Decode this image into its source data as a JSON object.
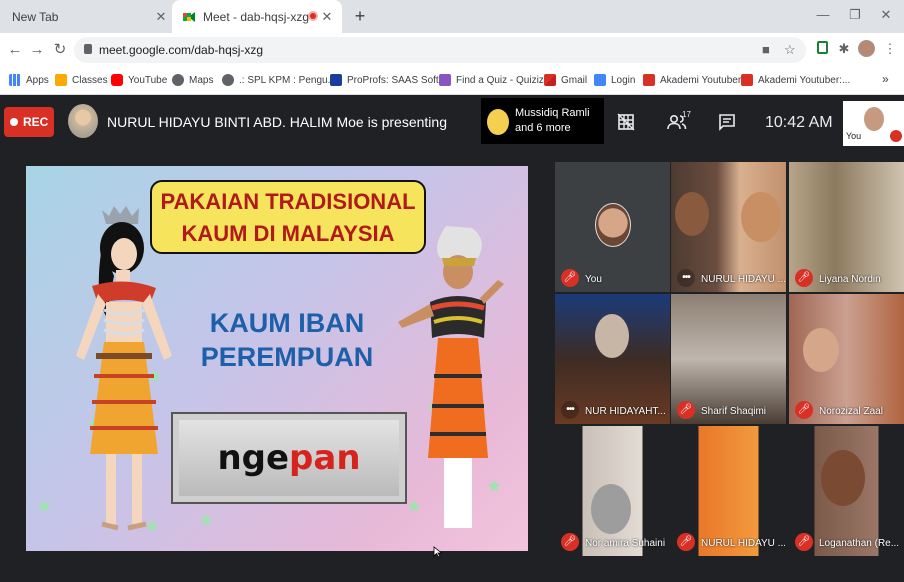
{
  "browser": {
    "tabs": [
      {
        "title": "New Tab",
        "active": false
      },
      {
        "title": "Meet - dab-hqsj-xzg",
        "active": true
      }
    ],
    "url": "meet.google.com/dab-hqsj-xzg",
    "bookmarks": [
      {
        "label": "Apps",
        "icon": "apps-grid-icon",
        "color": "#4285f4"
      },
      {
        "label": "Classes",
        "icon": "classroom-icon",
        "color": "#f9ab00"
      },
      {
        "label": "YouTube",
        "icon": "youtube-icon",
        "color": "#ff0000"
      },
      {
        "label": "Maps",
        "icon": "globe-icon",
        "color": "#5f6368"
      },
      {
        "label": ".: SPL KPM : Pengu...",
        "icon": "globe-icon",
        "color": "#5f6368"
      },
      {
        "label": "ProProfs: SAAS Soft...",
        "icon": "proprofs-icon",
        "color": "#1a3f9a"
      },
      {
        "label": "Find a Quiz - Quizizz",
        "icon": "quizizz-icon",
        "color": "#8854c0"
      },
      {
        "label": "Gmail",
        "icon": "gmail-icon",
        "color": "#d93025"
      },
      {
        "label": "Login",
        "icon": "login-icon",
        "color": "#4285f4"
      },
      {
        "label": "Akademi Youtuber",
        "icon": "akademi-icon",
        "color": "#d93025"
      },
      {
        "label": "Akademi Youtuber:...",
        "icon": "akademi-icon",
        "color": "#d93025"
      }
    ],
    "more_bookmarks": "»"
  },
  "meet": {
    "rec_label": "REC",
    "presenting_text": "NURUL HIDAYU BINTI ABD. HALIM Moe is presenting",
    "people_chip": {
      "line1": "Mussidiq Ramli",
      "line2": "and 6 more"
    },
    "participant_count": "17",
    "time": "10:42  AM",
    "self_label": "You"
  },
  "slide": {
    "title_line1": "PAKAIAN TRADISIONAL",
    "title_line2": "KAUM DI MALAYSIA",
    "subtitle_line1": "KAUM IBAN",
    "subtitle_line2": "PEREMPUAN",
    "answer_part1": "nge",
    "answer_part2": "pan"
  },
  "tiles": [
    {
      "name": "You",
      "status": "muted"
    },
    {
      "name": "NURUL HIDAYU ...",
      "status": "speaking"
    },
    {
      "name": "Liyana Nordin",
      "status": "muted"
    },
    {
      "name": "NUR HIDAYAHT...",
      "status": "speaking"
    },
    {
      "name": "Sharif Shaqimi",
      "status": "muted"
    },
    {
      "name": "Norozizal Zaal",
      "status": "muted"
    },
    {
      "name": "Nor amira Suhaini",
      "status": "muted"
    },
    {
      "name": "NURUL HIDAYU ...",
      "status": "muted"
    },
    {
      "name": "Loganathan (Re...",
      "status": "muted"
    }
  ]
}
